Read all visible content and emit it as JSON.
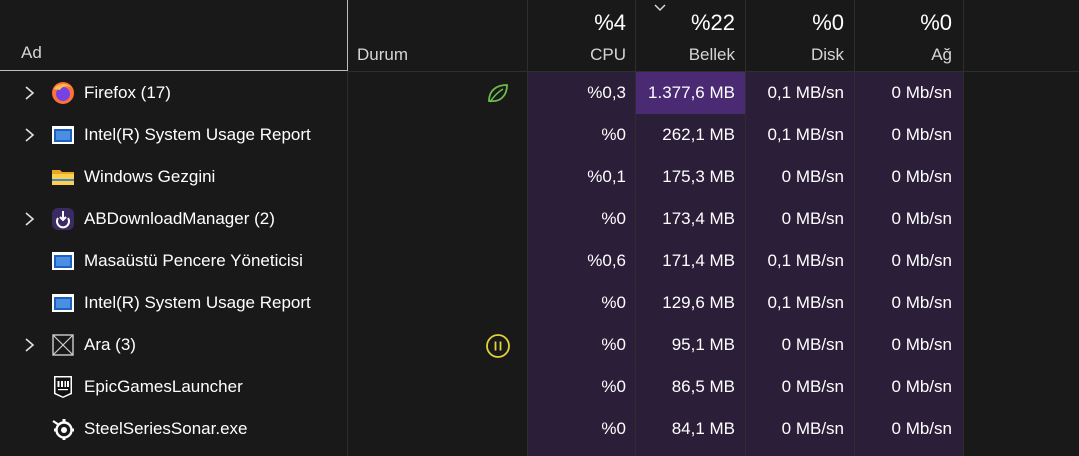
{
  "header": {
    "name_label": "Ad",
    "status_label": "Durum",
    "cpu": {
      "pct": "%4",
      "label": "CPU"
    },
    "memory": {
      "pct": "%22",
      "label": "Bellek"
    },
    "disk": {
      "pct": "%0",
      "label": "Disk"
    },
    "network": {
      "pct": "%0",
      "label": "Ağ"
    },
    "sort_indicator": "chevron-down-icon"
  },
  "colors": {
    "background": "#191919",
    "usage_column": "#2b1e39",
    "memory_highlight": "#4b2a74",
    "eco_green": "#6abf4b",
    "paused_yellow": "#e3d23a"
  },
  "processes": [
    {
      "name": "Firefox (17)",
      "expandable": true,
      "icon": "firefox-icon",
      "status": "eco-leaf-icon",
      "cpu": "%0,3",
      "memory": "1.377,6 MB",
      "disk": "0,1 MB/sn",
      "network": "0 Mb/sn"
    },
    {
      "name": "Intel(R) System Usage Report",
      "expandable": true,
      "icon": "app-window-icon",
      "status": "",
      "cpu": "%0",
      "memory": "262,1 MB",
      "disk": "0,1 MB/sn",
      "network": "0 Mb/sn"
    },
    {
      "name": "Windows Gezgini",
      "expandable": false,
      "icon": "folder-icon",
      "status": "",
      "cpu": "%0,1",
      "memory": "175,3 MB",
      "disk": "0 MB/sn",
      "network": "0 Mb/sn"
    },
    {
      "name": "ABDownloadManager (2)",
      "expandable": true,
      "icon": "download-manager-icon",
      "status": "",
      "cpu": "%0",
      "memory": "173,4 MB",
      "disk": "0 MB/sn",
      "network": "0 Mb/sn"
    },
    {
      "name": "Masaüstü Pencere Yöneticisi",
      "expandable": false,
      "icon": "app-window-icon",
      "status": "",
      "cpu": "%0,6",
      "memory": "171,4 MB",
      "disk": "0,1 MB/sn",
      "network": "0 Mb/sn"
    },
    {
      "name": "Intel(R) System Usage Report",
      "expandable": false,
      "icon": "app-window-icon",
      "status": "",
      "cpu": "%0",
      "memory": "129,6 MB",
      "disk": "0,1 MB/sn",
      "network": "0 Mb/sn"
    },
    {
      "name": "Ara (3)",
      "expandable": true,
      "icon": "search-box-icon",
      "status": "paused-icon",
      "cpu": "%0",
      "memory": "95,1 MB",
      "disk": "0 MB/sn",
      "network": "0 Mb/sn"
    },
    {
      "name": "EpicGamesLauncher",
      "expandable": false,
      "icon": "epic-games-icon",
      "status": "",
      "cpu": "%0",
      "memory": "86,5 MB",
      "disk": "0 MB/sn",
      "network": "0 Mb/sn"
    },
    {
      "name": "SteelSeriesSonar.exe",
      "expandable": false,
      "icon": "steelseries-icon",
      "status": "",
      "cpu": "%0",
      "memory": "84,1 MB",
      "disk": "0 MB/sn",
      "network": "0 Mb/sn"
    }
  ]
}
